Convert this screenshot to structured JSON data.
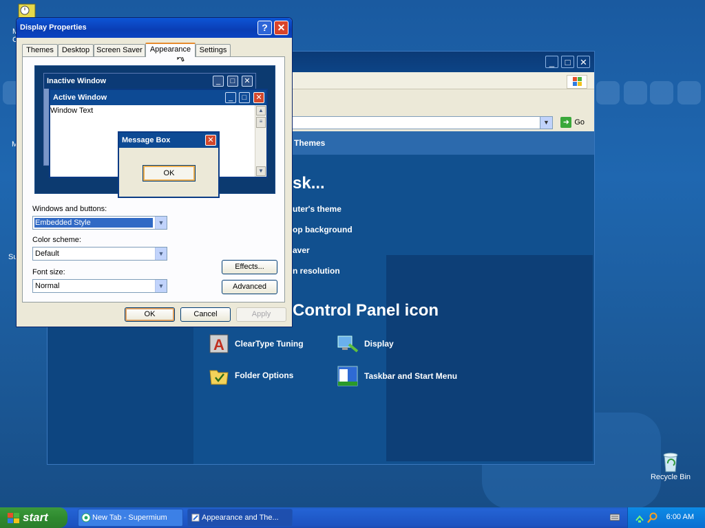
{
  "dialog": {
    "title": "Display Properties",
    "tabs": [
      "Themes",
      "Desktop",
      "Screen Saver",
      "Appearance",
      "Settings"
    ],
    "active_tab": "Appearance",
    "preview": {
      "inactive_window": "Inactive Window",
      "active_window": "Active Window",
      "window_text": "Window Text",
      "message_box": "Message Box",
      "message_ok": "OK"
    },
    "windows_buttons_label": "Windows and buttons:",
    "windows_buttons_value": "Embedded Style",
    "color_scheme_label": "Color scheme:",
    "color_scheme_value": "Default",
    "font_size_label": "Font size:",
    "font_size_value": "Normal",
    "effects_button": "Effects...",
    "advanced_button": "Advanced",
    "ok_button": "OK",
    "cancel_button": "Cancel",
    "apply_button": "Apply"
  },
  "control_panel": {
    "addr_go": "Go",
    "panel_header": "Themes",
    "pick_task": "sk...",
    "tasks": [
      "uter's theme",
      "op background",
      "aver",
      "n resolution"
    ],
    "pick_icon": "Control Panel icon",
    "items": [
      "ClearType Tuning",
      "Display",
      "Folder Options",
      "Taskbar and Start Menu"
    ]
  },
  "desktop": {
    "recycle_bin": "Recycle Bin",
    "frag_m1": "M",
    "frag_c1": "C",
    "frag_m2": "M",
    "frag_su": "Su"
  },
  "taskbar": {
    "start": "start",
    "tasks": [
      "New Tab - Supermium",
      "Appearance and The..."
    ],
    "clock": "6:00 AM"
  },
  "colors": {
    "desktop": "#1d5a9a",
    "xp_title_blue": "#0a3eb4",
    "dialog_face": "#ece9d8",
    "start_green": "#2f8a2f",
    "close_red": "#d9442a"
  }
}
